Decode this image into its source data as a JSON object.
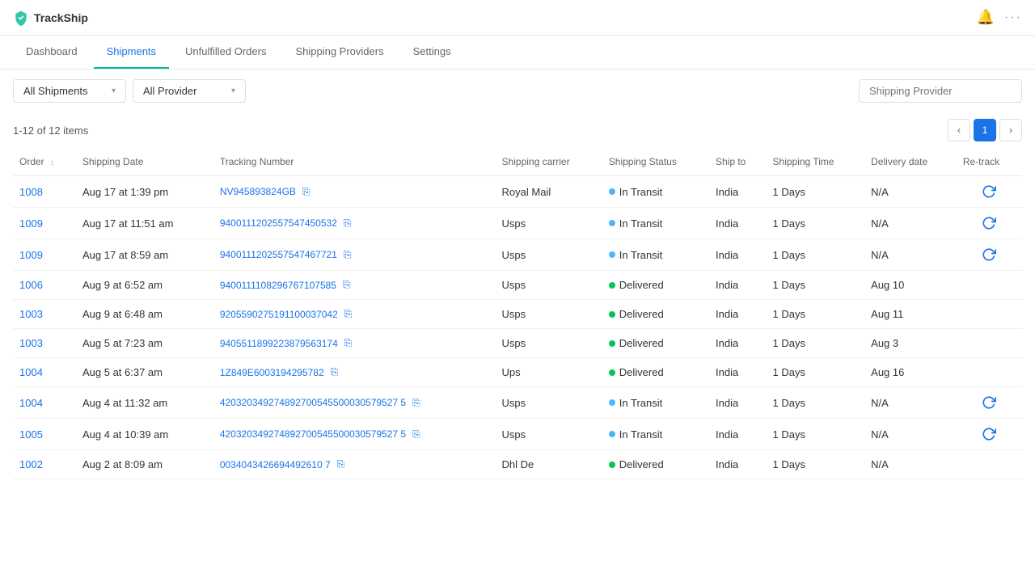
{
  "app": {
    "name": "TrackShip"
  },
  "nav": {
    "items": [
      {
        "label": "Dashboard",
        "active": false
      },
      {
        "label": "Shipments",
        "active": true
      },
      {
        "label": "Unfulfilled Orders",
        "active": false
      },
      {
        "label": "Shipping Providers",
        "active": false
      },
      {
        "label": "Settings",
        "active": false
      }
    ]
  },
  "toolbar": {
    "filter_all_shipments": "All Shipments",
    "filter_all_provider": "All Provider",
    "search_placeholder": "Shipping Provider"
  },
  "table_meta": {
    "count_text": "1-12 of 12 items",
    "page": "1"
  },
  "table": {
    "headers": [
      "Order",
      "Shipping Date",
      "Tracking Number",
      "Shipping carrier",
      "Shipping Status",
      "Ship to",
      "Shipping Time",
      "Delivery date",
      "Re-track"
    ],
    "rows": [
      {
        "order": "1008",
        "date": "Aug 17 at 1:39 pm",
        "tracking": "NV945893824GB",
        "carrier": "Royal Mail",
        "status": "In Transit",
        "status_type": "transit",
        "ship_to": "India",
        "shipping_time": "1 Days",
        "delivery_date": "N/A",
        "retrack": true
      },
      {
        "order": "1009",
        "date": "Aug 17 at 11:51 am",
        "tracking": "9400111202557547450532",
        "carrier": "Usps",
        "status": "In Transit",
        "status_type": "transit",
        "ship_to": "India",
        "shipping_time": "1 Days",
        "delivery_date": "N/A",
        "retrack": true
      },
      {
        "order": "1009",
        "date": "Aug 17 at 8:59 am",
        "tracking": "9400111202557547467721",
        "carrier": "Usps",
        "status": "In Transit",
        "status_type": "transit",
        "ship_to": "India",
        "shipping_time": "1 Days",
        "delivery_date": "N/A",
        "retrack": true
      },
      {
        "order": "1006",
        "date": "Aug 9 at 6:52 am",
        "tracking": "9400111108296767107585",
        "carrier": "Usps",
        "status": "Delivered",
        "status_type": "delivered",
        "ship_to": "India",
        "shipping_time": "1 Days",
        "delivery_date": "Aug 10",
        "retrack": false
      },
      {
        "order": "1003",
        "date": "Aug 9 at 6:48 am",
        "tracking": "9205590275191100037042",
        "carrier": "Usps",
        "status": "Delivered",
        "status_type": "delivered",
        "ship_to": "India",
        "shipping_time": "1 Days",
        "delivery_date": "Aug 11",
        "retrack": false
      },
      {
        "order": "1003",
        "date": "Aug 5 at 7:23 am",
        "tracking": "9405511899223879563174",
        "carrier": "Usps",
        "status": "Delivered",
        "status_type": "delivered",
        "ship_to": "India",
        "shipping_time": "1 Days",
        "delivery_date": "Aug 3",
        "retrack": false
      },
      {
        "order": "1004",
        "date": "Aug 5 at 6:37 am",
        "tracking": "1Z849E6003194295782",
        "carrier": "Ups",
        "status": "Delivered",
        "status_type": "delivered",
        "ship_to": "India",
        "shipping_time": "1 Days",
        "delivery_date": "Aug 16",
        "retrack": false
      },
      {
        "order": "1004",
        "date": "Aug 4 at 11:32 am",
        "tracking": "420320349274892700545500030579527 5",
        "carrier": "Usps",
        "status": "In Transit",
        "status_type": "transit",
        "ship_to": "India",
        "shipping_time": "1 Days",
        "delivery_date": "N/A",
        "retrack": true
      },
      {
        "order": "1005",
        "date": "Aug 4 at 10:39 am",
        "tracking": "420320349274892700545500030579527 5",
        "carrier": "Usps",
        "status": "In Transit",
        "status_type": "transit",
        "ship_to": "India",
        "shipping_time": "1 Days",
        "delivery_date": "N/A",
        "retrack": true
      },
      {
        "order": "1002",
        "date": "Aug 2 at 8:09 am",
        "tracking": "0034043426694492610 7",
        "carrier": "Dhl De",
        "status": "Delivered",
        "status_type": "delivered",
        "ship_to": "India",
        "shipping_time": "1 Days",
        "delivery_date": "N/A",
        "retrack": false
      }
    ]
  }
}
